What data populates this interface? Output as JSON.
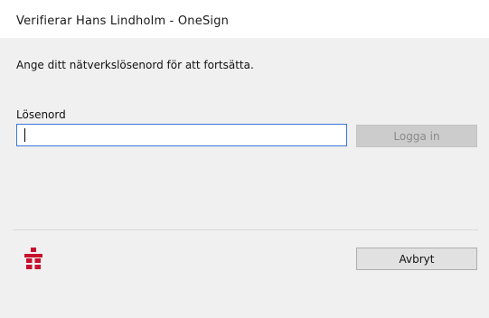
{
  "window": {
    "title": "Verifierar Hans Lindholm - OneSign"
  },
  "dialog": {
    "prompt": "Ange ditt nätverkslösenord för att fortsätta.",
    "password_label": "Lösenord",
    "password_value": "",
    "login_label": "Logga in",
    "cancel_label": "Avbryt"
  },
  "colors": {
    "input_focus_border": "#3a76d6",
    "logo_red": "#c8102e",
    "disabled_button_bg": "#cccccc"
  },
  "icons": {
    "brand": "onesign-logo-icon"
  }
}
